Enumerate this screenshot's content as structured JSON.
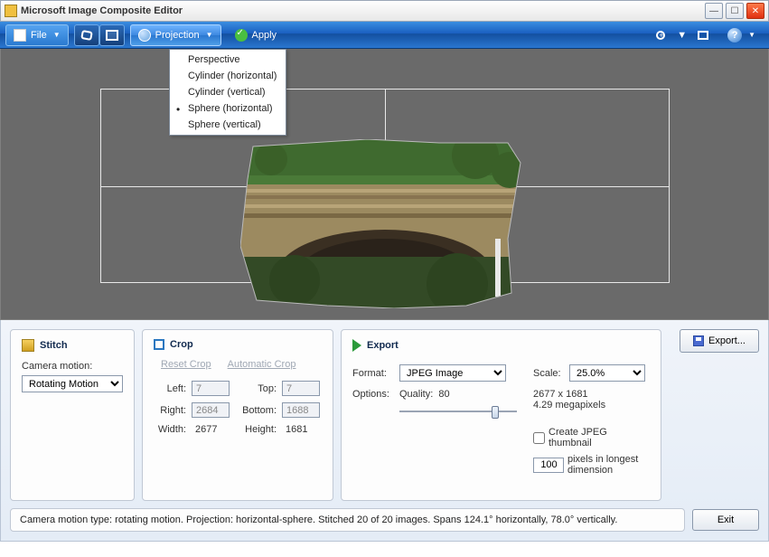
{
  "title": "Microsoft Image Composite Editor",
  "toolbar": {
    "file": "File",
    "projection": "Projection",
    "apply": "Apply"
  },
  "projection_menu": {
    "items": [
      {
        "label": "Perspective",
        "checked": false
      },
      {
        "label": "Cylinder (horizontal)",
        "checked": false
      },
      {
        "label": "Cylinder (vertical)",
        "checked": false
      },
      {
        "label": "Sphere (horizontal)",
        "checked": true
      },
      {
        "label": "Sphere (vertical)",
        "checked": false
      }
    ]
  },
  "stitch": {
    "title": "Stitch",
    "camera_motion_label": "Camera motion:",
    "camera_motion_value": "Rotating Motion"
  },
  "crop": {
    "title": "Crop",
    "reset": "Reset Crop",
    "auto": "Automatic Crop",
    "left_l": "Left:",
    "left_v": "7",
    "top_l": "Top:",
    "top_v": "7",
    "right_l": "Right:",
    "right_v": "2684",
    "bottom_l": "Bottom:",
    "bottom_v": "1688",
    "width_l": "Width:",
    "width_v": "2677",
    "height_l": "Height:",
    "height_v": "1681"
  },
  "export": {
    "title": "Export",
    "format_l": "Format:",
    "format_v": "JPEG Image",
    "options_l": "Options:",
    "quality_l": "Quality:",
    "quality_v": "80",
    "scale_l": "Scale:",
    "scale_v": "25.0%",
    "dims": "2677 x 1681",
    "mpix": "4.29 megapixels",
    "thumb": "Create JPEG thumbnail",
    "thumb_px": "100",
    "thumb_caption": "pixels in longest dimension",
    "button": "Export..."
  },
  "status": "Camera motion type: rotating motion. Projection: horizontal-sphere. Stitched 20 of 20 images. Spans 124.1° horizontally, 78.0° vertically.",
  "exit": "Exit"
}
